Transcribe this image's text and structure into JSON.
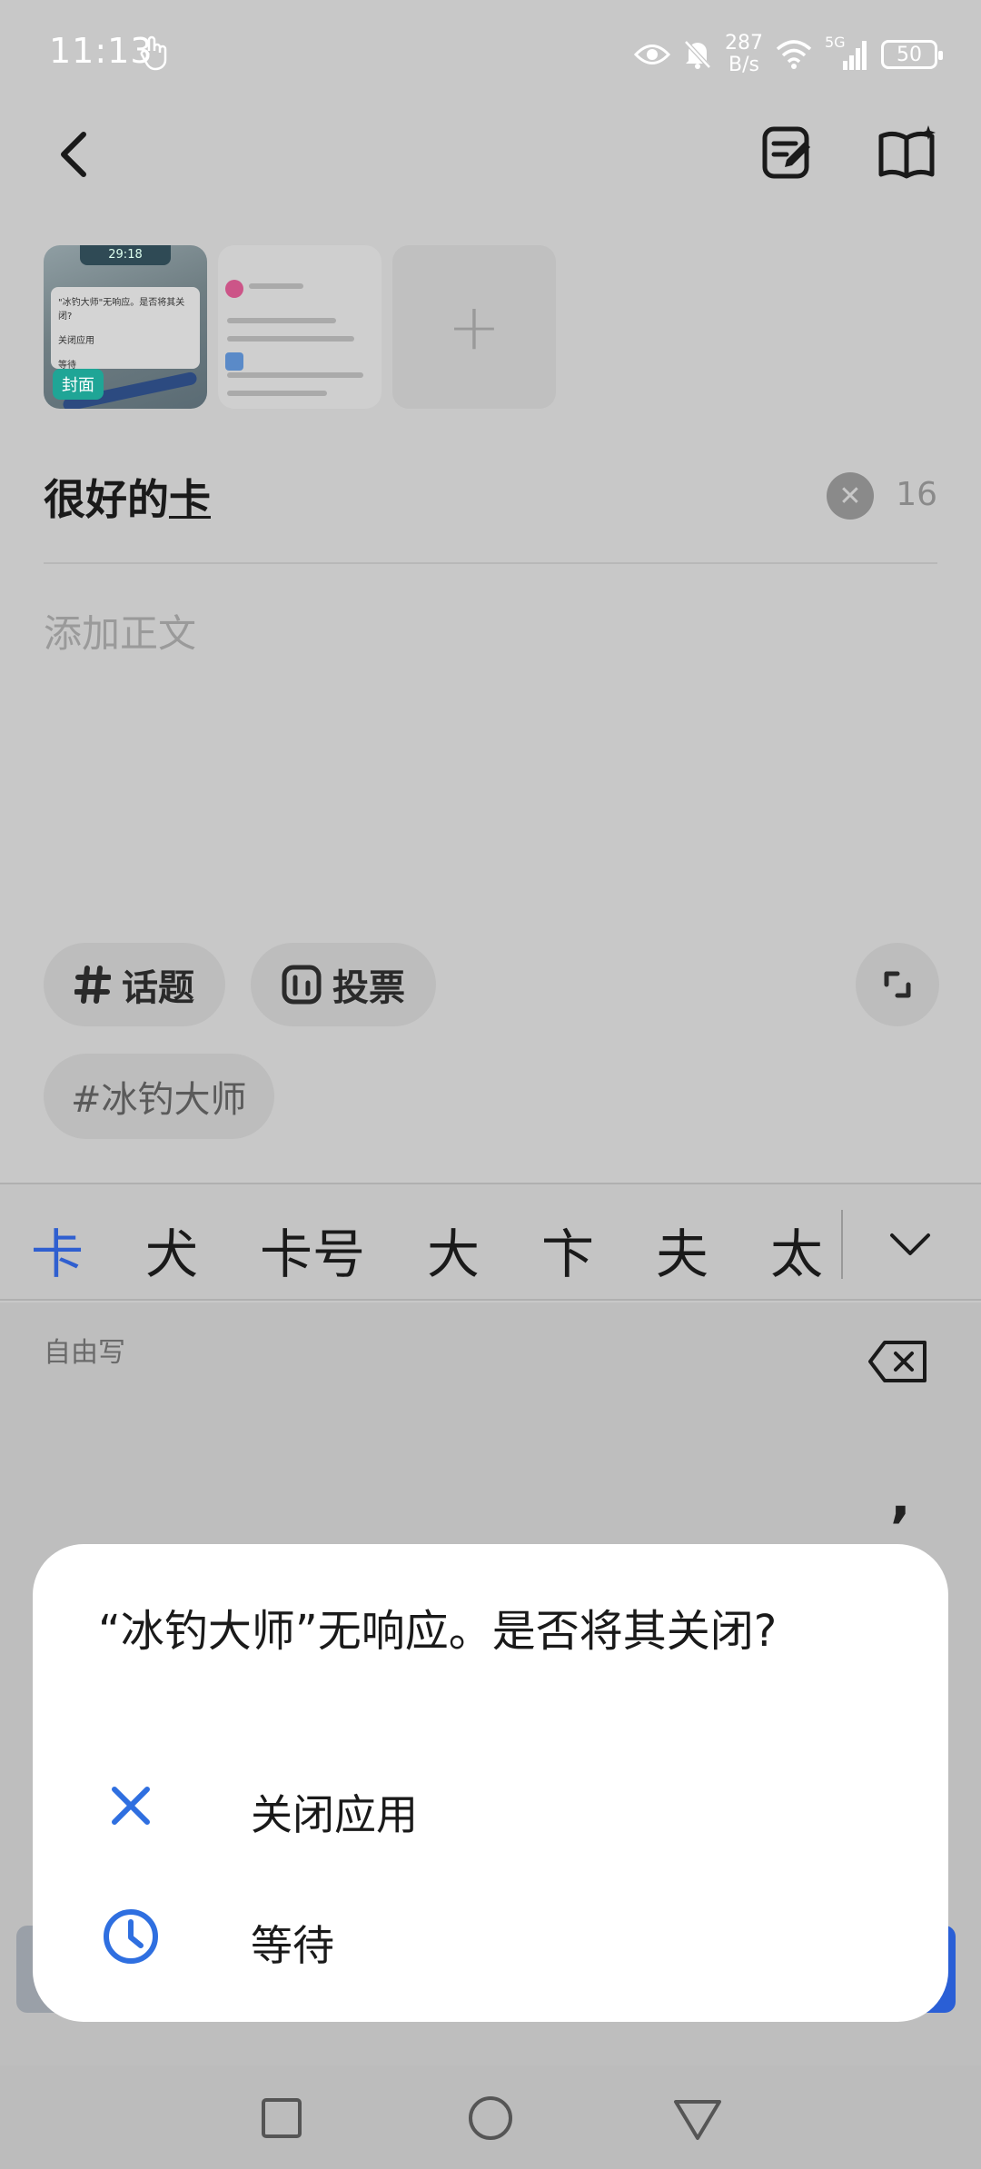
{
  "status_bar": {
    "time": "11:13",
    "net_speed_value": "287",
    "net_speed_unit": "B/s",
    "network": "5G",
    "battery": "50"
  },
  "composer": {
    "cover_label": "封面",
    "thumb1_timer": "29:18",
    "thumb1_dialog_title": "\"冰钓大师\"无响应。是否将其关闭?",
    "thumb1_opt1": "关闭应用",
    "thumb1_opt2": "等待",
    "add_image": "+",
    "title": "很好的",
    "title_composing": "卡",
    "title_count": "16",
    "body_placeholder": "添加正文",
    "topic_chip": "话题",
    "vote_chip": "投票",
    "tag_chip": "#冰钓大师"
  },
  "ime": {
    "candidates": [
      "卡",
      "犬",
      "卡号",
      "大",
      "卞",
      "夫",
      "太"
    ],
    "mode_label": "自由写",
    "comma": ","
  },
  "dialog": {
    "title": "“冰钓大师”无响应。是否将其关闭?",
    "options": [
      {
        "label": "关闭应用",
        "icon": "close-icon"
      },
      {
        "label": "等待",
        "icon": "clock-icon"
      }
    ]
  },
  "colors": {
    "accent": "#2f6fe0",
    "overlay": "#c8c8c8"
  }
}
